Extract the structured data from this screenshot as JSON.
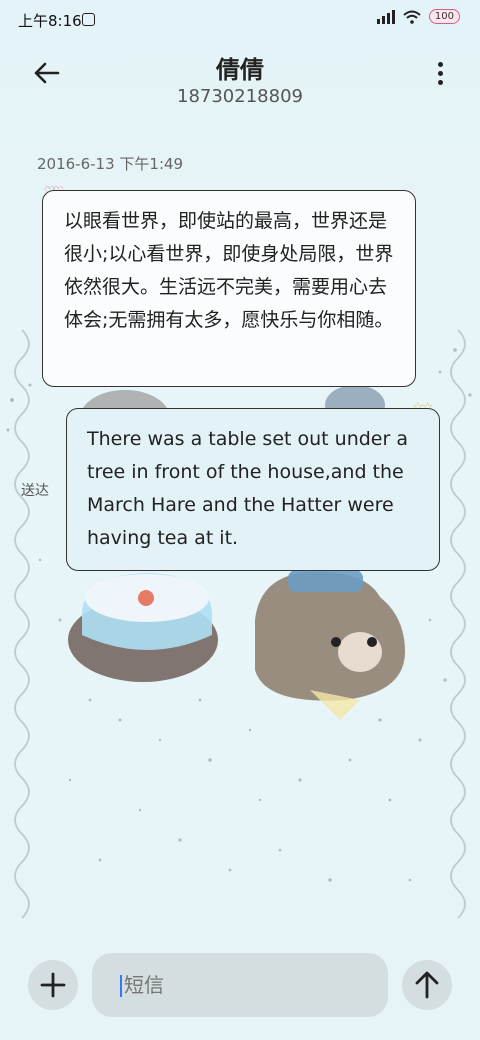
{
  "status_bar": {
    "time": "上午8:16",
    "battery": "100"
  },
  "header": {
    "contact_name": "倩倩",
    "phone_number": "18730218809"
  },
  "conversation": {
    "timestamp": "2016-6-13 下午1:49",
    "messages": [
      {
        "direction": "incoming",
        "text": "以眼看世界，即使站的最高，世界还是很小;以心看世界，即使身处局限，世界依然很大。生活远不完美，需要用心去体会;无需拥有太多，愿快乐与你相随。"
      },
      {
        "direction": "outgoing",
        "text": "There was a table set out under a tree in front of the house,and the March Hare and the Hatter were having tea at it.",
        "status": "送达"
      }
    ]
  },
  "composer": {
    "placeholder": "短信",
    "value": ""
  },
  "icons": {
    "back": "arrow-left-icon",
    "more": "more-vertical-icon",
    "add": "plus-icon",
    "send": "arrow-up-icon"
  },
  "colors": {
    "background": "#e4f3f7",
    "incoming_bubble": "#fbfcfd",
    "outgoing_bubble": "#e2f2f7",
    "composer": "#d4dde0"
  }
}
